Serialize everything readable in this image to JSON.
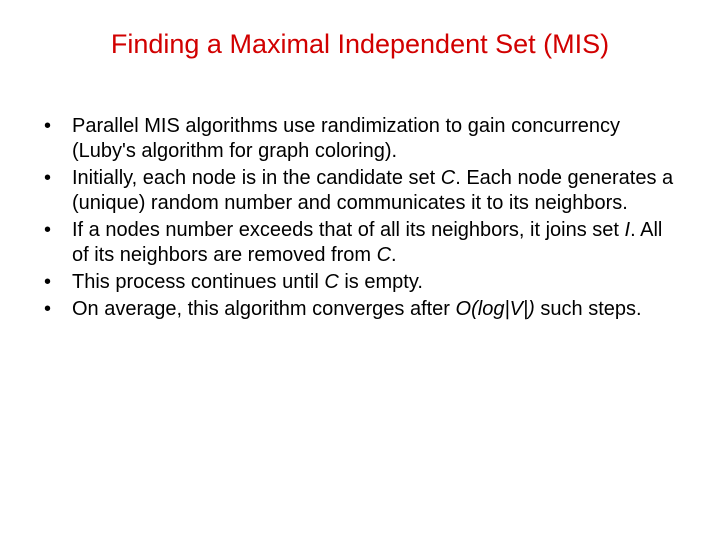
{
  "title": "Finding a Maximal Independent Set (MIS)",
  "bullets": [
    {
      "html": "Parallel MIS algorithms use randimization to gain concurrency (Luby's algorithm for graph coloring)."
    },
    {
      "html": "Initially, each node is in the candidate set <span class=\"ital\">C</span>. Each node generates a (unique) random number and communicates it to its neighbors."
    },
    {
      "html": "If a nodes number exceeds that of all its neighbors, it joins set <span class=\"ital\">I</span>. All of its neighbors are removed from <span class=\"ital\">C</span>."
    },
    {
      "html": "This process continues until <span class=\"ital\">C</span> is empty."
    },
    {
      "html": "On average, this algorithm converges after <span class=\"ital\">O(log|V|)</span> such steps."
    }
  ]
}
